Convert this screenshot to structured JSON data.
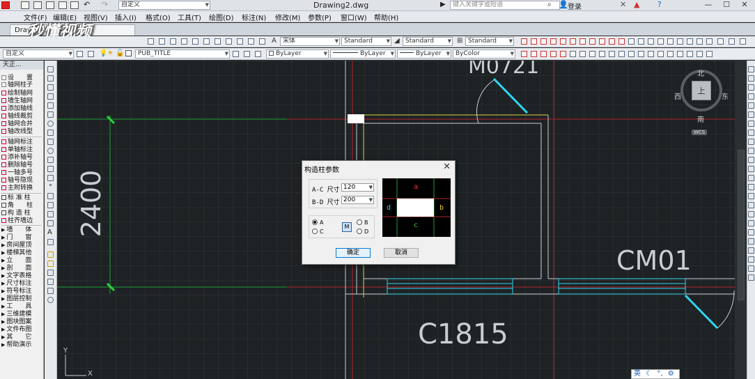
{
  "titlebar": {
    "doc_title": "Drawing2.dwg",
    "workspace": "自定义",
    "search_placeholder": "键入关键字或短语",
    "login": "登录"
  },
  "menu": [
    "文件(F)",
    "编辑(E)",
    "视图(V)",
    "插入(I)",
    "格式(O)",
    "工具(T)",
    "绘图(D)",
    "标注(N)",
    "修改(M)",
    "参数(P)",
    "窗口(W)",
    "帮助(H)"
  ],
  "tab": {
    "label": "Drav",
    "watermark": "秒懂视频"
  },
  "toolbar2": {
    "font": "宋体",
    "text_style": "Standard",
    "dim_style": "Standard",
    "table_style": "Standard"
  },
  "toolbar3": {
    "workspace": "自定义",
    "layer": "PUB_TITLE",
    "color": "ByLayer",
    "linetype": "ByLayer",
    "lineweight": "ByLayer",
    "plotstyle": "ByColor"
  },
  "palette": {
    "title": "天正...",
    "items": [
      "设　　置",
      "轴网柱子",
      "绘制轴网",
      "墙生轴网",
      "添加轴线",
      "轴线裁剪",
      "轴网合并",
      "轴改线型",
      "轴网标注",
      "单轴标注",
      "添补轴号",
      "删除轴号",
      "一轴多号",
      "轴号隐现",
      "主附转换",
      "标 准 柱",
      "角　　柱",
      "构 造 柱",
      "柱齐墙边",
      "墙　　体",
      "门　　窗",
      "房间屋顶",
      "楼梯其他",
      "立　　面",
      "剖　　面",
      "文字表格",
      "尺寸标注",
      "符号标注",
      "图层控制",
      "工　　具",
      "三维建模",
      "图块图案",
      "文件布图",
      "其　　它",
      "帮助演示"
    ]
  },
  "drawing": {
    "dim_2400": "2400",
    "door_label": "M0721",
    "window_cm01": "CM01",
    "window_c1815": "C1815",
    "ucs_x": "X",
    "ucs_y": "Y"
  },
  "viewcube": {
    "north": "北",
    "south": "南",
    "east": "东",
    "west": "西",
    "center": "上",
    "wcs": "WCS"
  },
  "dialog": {
    "title": "构造柱参数",
    "ac_label": "A-C 尺寸",
    "ac_value": "120",
    "bd_label": "B-D 尺寸",
    "bd_value": "200",
    "radio_a": "A",
    "radio_b": "B",
    "radio_c": "C",
    "radio_d": "D",
    "selected": "A",
    "swap_label": "M",
    "preview": {
      "a": "a",
      "b": "b",
      "c": "c",
      "d": "d"
    },
    "ok": "确定",
    "cancel": "取消"
  },
  "imebar": {
    "lang": "英"
  }
}
